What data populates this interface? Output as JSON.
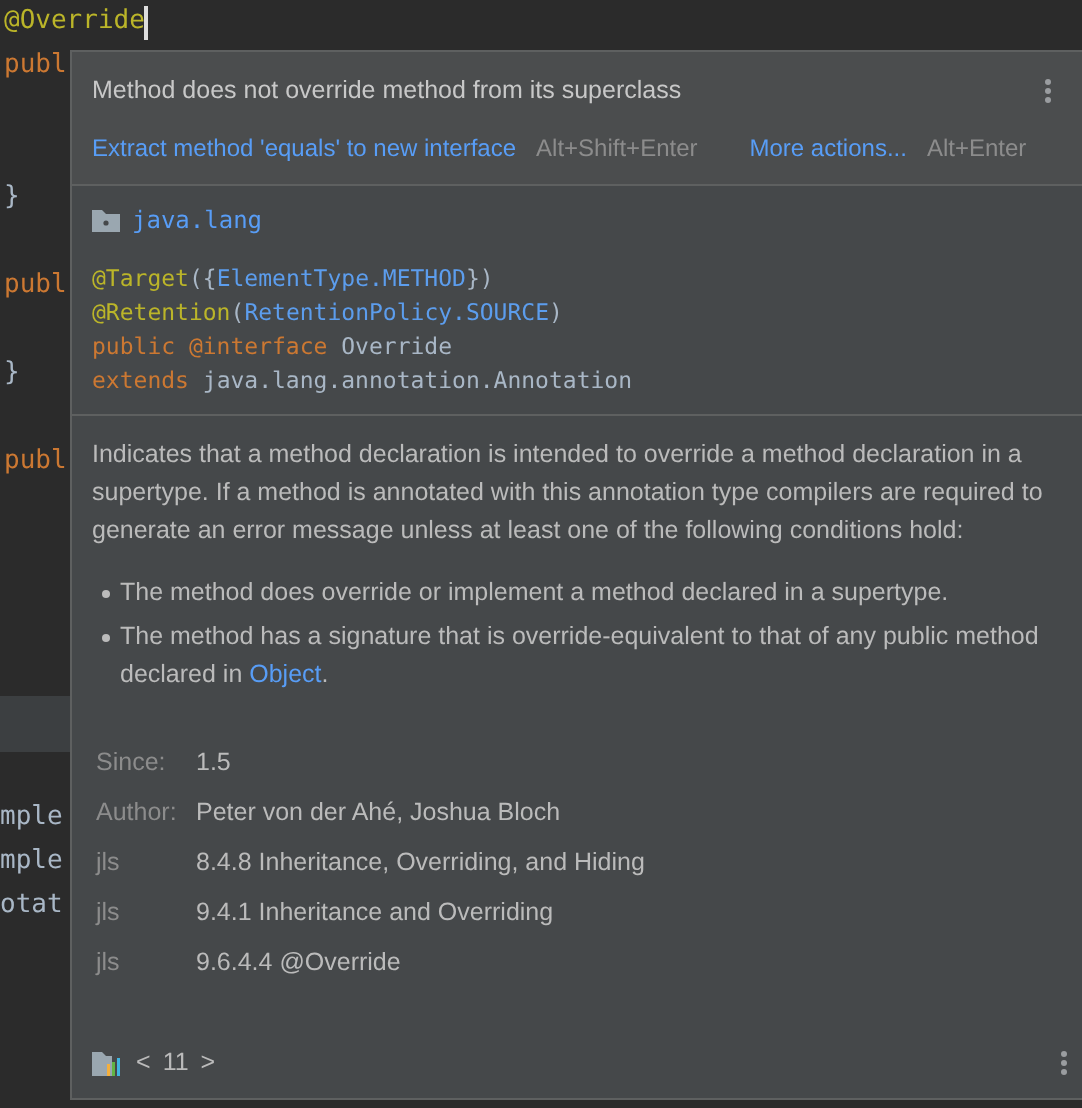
{
  "editor": {
    "lines": [
      {
        "kind": "annotation",
        "text": "@Override",
        "caret": true
      },
      {
        "kind": "keyword",
        "text": "publ",
        "caret": false
      },
      {
        "kind": "blank"
      },
      {
        "kind": "blank"
      },
      {
        "kind": "plain",
        "text": "}",
        "caret": false
      },
      {
        "kind": "blank"
      },
      {
        "kind": "keyword",
        "text": "publ",
        "caret": false
      },
      {
        "kind": "blank"
      },
      {
        "kind": "plain",
        "text": "}",
        "caret": false
      },
      {
        "kind": "blank"
      },
      {
        "kind": "keyword",
        "text": "publ",
        "caret": false
      }
    ],
    "bottom_lines": [
      "mple",
      "mple",
      "otat"
    ]
  },
  "popup": {
    "problem": "Method does not override method from its superclass",
    "actions": [
      {
        "label": "Extract method 'equals' to new interface",
        "shortcut": "Alt+Shift+Enter"
      },
      {
        "label": "More actions...",
        "shortcut": "Alt+Enter"
      }
    ],
    "package": "java.lang",
    "declaration": [
      [
        {
          "kind": "annotation",
          "text": "@Target"
        },
        {
          "kind": "plain",
          "text": "({"
        },
        {
          "kind": "constant",
          "text": "ElementType.METHOD"
        },
        {
          "kind": "plain",
          "text": "})"
        }
      ],
      [
        {
          "kind": "annotation",
          "text": "@Retention"
        },
        {
          "kind": "plain",
          "text": "("
        },
        {
          "kind": "constant",
          "text": "RetentionPolicy.SOURCE"
        },
        {
          "kind": "plain",
          "text": ")"
        }
      ],
      [
        {
          "kind": "keyword",
          "text": "public @interface "
        },
        {
          "kind": "plain",
          "text": "Override"
        }
      ],
      [
        {
          "kind": "keyword",
          "text": "extends "
        },
        {
          "kind": "plain",
          "text": "java.lang.annotation.Annotation"
        }
      ]
    ],
    "description": "Indicates that a method declaration is intended to override a method declaration in a supertype. If a method is annotated with this annotation type compilers are required to generate an error message unless at least one of the following conditions hold:",
    "conditions": [
      {
        "text": "The method does override or implement a method declared in a supertype."
      },
      {
        "text": "The method has a signature that is override-equivalent to that of any public method declared in ",
        "link": "Object",
        "after": "."
      }
    ],
    "tags": [
      {
        "label": "Since:",
        "value": "1.5"
      },
      {
        "label": "Author:",
        "value": "Peter von der Ahé, Joshua Bloch"
      },
      {
        "label": "jls",
        "value": "8.4.8 Inheritance, Overriding, and Hiding"
      },
      {
        "label": "jls",
        "value": "9.4.1 Inheritance and Overriding"
      },
      {
        "label": "jls",
        "value": "9.6.4.4 @Override"
      }
    ],
    "footer": {
      "prev": "<",
      "version": "11",
      "next": ">"
    }
  }
}
